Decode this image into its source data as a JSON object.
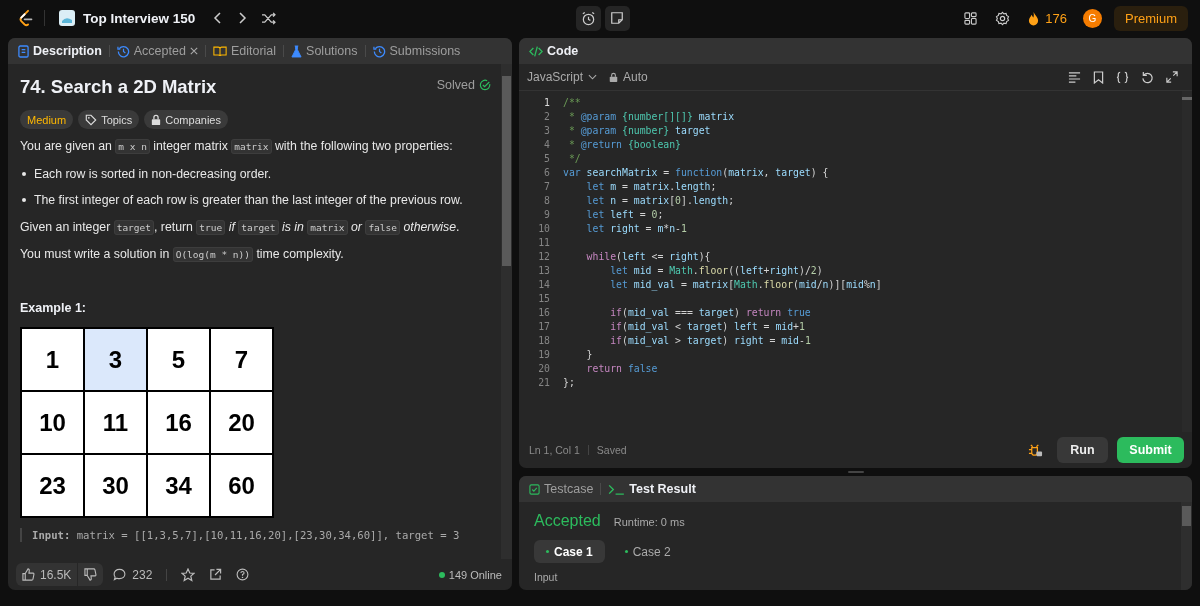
{
  "topbar": {
    "list_title": "Top Interview 150",
    "streak": "176",
    "avatar": "G",
    "premium": "Premium"
  },
  "left_tabs": [
    {
      "label": "Description",
      "kind": "doc",
      "selected": true,
      "closable": false
    },
    {
      "label": "Accepted",
      "kind": "history",
      "selected": false,
      "closable": true
    },
    {
      "label": "Editorial",
      "kind": "book",
      "selected": false,
      "closable": false
    },
    {
      "label": "Solutions",
      "kind": "flask",
      "selected": false,
      "closable": false
    },
    {
      "label": "Submissions",
      "kind": "history",
      "selected": false,
      "closable": false
    }
  ],
  "problem": {
    "title": "74. Search a 2D Matrix",
    "status": "Solved",
    "difficulty": "Medium",
    "tags": [
      {
        "label": "Topics",
        "kind": "tag"
      },
      {
        "label": "Companies",
        "kind": "lock"
      }
    ],
    "paragraphs": [
      {
        "kind": "para",
        "parts": [
          {
            "kind": "text",
            "text": "You are given an "
          },
          {
            "kind": "code",
            "text": "m x n"
          },
          {
            "kind": "text",
            "text": " integer matrix "
          },
          {
            "kind": "code",
            "text": "matrix"
          },
          {
            "kind": "text",
            "text": " with the following two properties:"
          }
        ]
      },
      {
        "kind": "bullet",
        "parts": [
          {
            "kind": "text",
            "text": "Each row is sorted in non-decreasing order."
          }
        ]
      },
      {
        "kind": "bullet",
        "parts": [
          {
            "kind": "text",
            "text": "The first integer of each row is greater than the last integer of the previous row."
          }
        ]
      },
      {
        "kind": "para",
        "parts": [
          {
            "kind": "text",
            "text": "Given an integer "
          },
          {
            "kind": "code",
            "text": "target"
          },
          {
            "kind": "text",
            "text": ", return "
          },
          {
            "kind": "code",
            "text": "true"
          },
          {
            "kind": "italic",
            "text": " if "
          },
          {
            "kind": "code",
            "text": "target"
          },
          {
            "kind": "italic",
            "text": " is in "
          },
          {
            "kind": "code",
            "text": "matrix"
          },
          {
            "kind": "italic",
            "text": " or "
          },
          {
            "kind": "code",
            "text": "false"
          },
          {
            "kind": "italic",
            "text": " otherwise"
          },
          {
            "kind": "text",
            "text": "."
          }
        ]
      },
      {
        "kind": "para",
        "parts": [
          {
            "kind": "text",
            "text": "You must write a solution in "
          },
          {
            "kind": "code",
            "text": "O(log(m * n))"
          },
          {
            "kind": "text",
            "text": " time complexity."
          }
        ]
      }
    ],
    "example_title": "Example 1:",
    "matrix": [
      [
        {
          "value": "1",
          "selected": false
        },
        {
          "value": "3",
          "selected": true
        },
        {
          "value": "5",
          "selected": false
        },
        {
          "value": "7",
          "selected": false
        }
      ],
      [
        {
          "value": "10",
          "selected": false
        },
        {
          "value": "11",
          "selected": false
        },
        {
          "value": "16",
          "selected": false
        },
        {
          "value": "20",
          "selected": false
        }
      ],
      [
        {
          "value": "23",
          "selected": false
        },
        {
          "value": "30",
          "selected": false
        },
        {
          "value": "34",
          "selected": false
        },
        {
          "value": "60",
          "selected": false
        }
      ]
    ],
    "example_input": "**Input:** matrix = [[1,3,5,7],[10,11,16,20],[23,30,34,60]], target = 3"
  },
  "bottom_bar": {
    "likes": "16.5K",
    "comments": "232",
    "online": "149 Online"
  },
  "code_panel": {
    "title": "Code",
    "language": "JavaScript",
    "mode": "Auto",
    "cursor": "Ln 1, Col 1",
    "save_state": "Saved",
    "run": "Run",
    "submit": "Submit",
    "lines": [
      {
        "number": "1",
        "tokens": [
          {
            "kind": "comment",
            "text": "/**"
          }
        ]
      },
      {
        "number": "2",
        "tokens": [
          {
            "kind": "comment",
            "text": " * "
          },
          {
            "kind": "doctag",
            "text": "@param "
          },
          {
            "kind": "type",
            "text": "{number[][]}"
          },
          {
            "kind": "var",
            "text": " matrix"
          }
        ]
      },
      {
        "number": "3",
        "tokens": [
          {
            "kind": "comment",
            "text": " * "
          },
          {
            "kind": "doctag",
            "text": "@param "
          },
          {
            "kind": "type",
            "text": "{number}"
          },
          {
            "kind": "var",
            "text": " target"
          }
        ]
      },
      {
        "number": "4",
        "tokens": [
          {
            "kind": "comment",
            "text": " * "
          },
          {
            "kind": "doctag",
            "text": "@return "
          },
          {
            "kind": "type",
            "text": "{boolean}"
          }
        ]
      },
      {
        "number": "5",
        "tokens": [
          {
            "kind": "comment",
            "text": " */"
          }
        ]
      },
      {
        "number": "6",
        "tokens": [
          {
            "kind": "keyword",
            "text": "var"
          },
          {
            "kind": "var",
            "text": " searchMatrix "
          },
          {
            "kind": "plain",
            "text": "= "
          },
          {
            "kind": "keyword",
            "text": "function"
          },
          {
            "kind": "plain",
            "text": "("
          },
          {
            "kind": "var",
            "text": "matrix"
          },
          {
            "kind": "plain",
            "text": ", "
          },
          {
            "kind": "var",
            "text": "target"
          },
          {
            "kind": "plain",
            "text": ") {"
          }
        ]
      },
      {
        "number": "7",
        "tokens": [
          {
            "kind": "keyword",
            "text": "    let"
          },
          {
            "kind": "var",
            "text": " m "
          },
          {
            "kind": "plain",
            "text": "= "
          },
          {
            "kind": "var",
            "text": "matrix"
          },
          {
            "kind": "plain",
            "text": "."
          },
          {
            "kind": "var",
            "text": "length"
          },
          {
            "kind": "plain",
            "text": ";"
          }
        ]
      },
      {
        "number": "8",
        "tokens": [
          {
            "kind": "keyword",
            "text": "    let"
          },
          {
            "kind": "var",
            "text": " n "
          },
          {
            "kind": "plain",
            "text": "= "
          },
          {
            "kind": "var",
            "text": "matrix"
          },
          {
            "kind": "plain",
            "text": "["
          },
          {
            "kind": "number",
            "text": "0"
          },
          {
            "kind": "plain",
            "text": "]."
          },
          {
            "kind": "var",
            "text": "length"
          },
          {
            "kind": "plain",
            "text": ";"
          }
        ]
      },
      {
        "number": "9",
        "tokens": [
          {
            "kind": "keyword",
            "text": "    let"
          },
          {
            "kind": "var",
            "text": " left "
          },
          {
            "kind": "plain",
            "text": "= "
          },
          {
            "kind": "number",
            "text": "0"
          },
          {
            "kind": "plain",
            "text": ";"
          }
        ]
      },
      {
        "number": "10",
        "tokens": [
          {
            "kind": "keyword",
            "text": "    let"
          },
          {
            "kind": "var",
            "text": " right "
          },
          {
            "kind": "plain",
            "text": "= "
          },
          {
            "kind": "var",
            "text": "m"
          },
          {
            "kind": "plain",
            "text": "*"
          },
          {
            "kind": "var",
            "text": "n"
          },
          {
            "kind": "plain",
            "text": "-"
          },
          {
            "kind": "number",
            "text": "1"
          }
        ]
      },
      {
        "number": "11"
      },
      {
        "number": "12",
        "tokens": [
          {
            "kind": "control",
            "text": "    while"
          },
          {
            "kind": "plain",
            "text": "("
          },
          {
            "kind": "var",
            "text": "left"
          },
          {
            "kind": "plain",
            "text": " <= "
          },
          {
            "kind": "var",
            "text": "right"
          },
          {
            "kind": "plain",
            "text": "){"
          }
        ]
      },
      {
        "number": "13",
        "tokens": [
          {
            "kind": "keyword",
            "text": "        let"
          },
          {
            "kind": "var",
            "text": " mid "
          },
          {
            "kind": "plain",
            "text": "= "
          },
          {
            "kind": "class",
            "text": "Math"
          },
          {
            "kind": "plain",
            "text": "."
          },
          {
            "kind": "func",
            "text": "floor"
          },
          {
            "kind": "plain",
            "text": "(("
          },
          {
            "kind": "var",
            "text": "left"
          },
          {
            "kind": "plain",
            "text": "+"
          },
          {
            "kind": "var",
            "text": "right"
          },
          {
            "kind": "plain",
            "text": ")/"
          },
          {
            "kind": "number",
            "text": "2"
          },
          {
            "kind": "plain",
            "text": ")"
          }
        ]
      },
      {
        "number": "14",
        "tokens": [
          {
            "kind": "keyword",
            "text": "        let"
          },
          {
            "kind": "var",
            "text": " mid_val "
          },
          {
            "kind": "plain",
            "text": "= "
          },
          {
            "kind": "var",
            "text": "matrix"
          },
          {
            "kind": "plain",
            "text": "["
          },
          {
            "kind": "class",
            "text": "Math"
          },
          {
            "kind": "plain",
            "text": "."
          },
          {
            "kind": "func",
            "text": "floor"
          },
          {
            "kind": "plain",
            "text": "("
          },
          {
            "kind": "var",
            "text": "mid"
          },
          {
            "kind": "plain",
            "text": "/"
          },
          {
            "kind": "var",
            "text": "n"
          },
          {
            "kind": "plain",
            "text": ")]["
          },
          {
            "kind": "var",
            "text": "mid"
          },
          {
            "kind": "plain",
            "text": "%"
          },
          {
            "kind": "var",
            "text": "n"
          },
          {
            "kind": "plain",
            "text": "]"
          }
        ]
      },
      {
        "number": "15"
      },
      {
        "number": "16",
        "tokens": [
          {
            "kind": "control",
            "text": "        if"
          },
          {
            "kind": "plain",
            "text": "("
          },
          {
            "kind": "var",
            "text": "mid_val"
          },
          {
            "kind": "plain",
            "text": " === "
          },
          {
            "kind": "var",
            "text": "target"
          },
          {
            "kind": "plain",
            "text": ") "
          },
          {
            "kind": "control",
            "text": "return "
          },
          {
            "kind": "keyword",
            "text": "true"
          }
        ]
      },
      {
        "number": "17",
        "tokens": [
          {
            "kind": "control",
            "text": "        if"
          },
          {
            "kind": "plain",
            "text": "("
          },
          {
            "kind": "var",
            "text": "mid_val"
          },
          {
            "kind": "plain",
            "text": " < "
          },
          {
            "kind": "var",
            "text": "target"
          },
          {
            "kind": "plain",
            "text": ") "
          },
          {
            "kind": "var",
            "text": "left"
          },
          {
            "kind": "plain",
            "text": " = "
          },
          {
            "kind": "var",
            "text": "mid"
          },
          {
            "kind": "plain",
            "text": "+"
          },
          {
            "kind": "number",
            "text": "1"
          }
        ]
      },
      {
        "number": "18",
        "tokens": [
          {
            "kind": "control",
            "text": "        if"
          },
          {
            "kind": "plain",
            "text": "("
          },
          {
            "kind": "var",
            "text": "mid_val"
          },
          {
            "kind": "plain",
            "text": " > "
          },
          {
            "kind": "var",
            "text": "target"
          },
          {
            "kind": "plain",
            "text": ") "
          },
          {
            "kind": "var",
            "text": "right"
          },
          {
            "kind": "plain",
            "text": " = "
          },
          {
            "kind": "var",
            "text": "mid"
          },
          {
            "kind": "plain",
            "text": "-"
          },
          {
            "kind": "number",
            "text": "1"
          }
        ]
      },
      {
        "number": "19",
        "tokens": [
          {
            "kind": "plain",
            "text": "    }"
          }
        ]
      },
      {
        "number": "20",
        "tokens": [
          {
            "kind": "control",
            "text": "    return "
          },
          {
            "kind": "keyword",
            "text": "false"
          }
        ]
      },
      {
        "number": "21",
        "tokens": [
          {
            "kind": "plain",
            "text": "};"
          }
        ]
      }
    ]
  },
  "result_panel": {
    "tabs": [
      {
        "label": "Testcase",
        "kind": "check",
        "selected": false
      },
      {
        "label": "Test Result",
        "kind": "terminal",
        "selected": true
      }
    ],
    "verdict": "Accepted",
    "runtime": "Runtime: 0 ms",
    "cases": [
      {
        "label": "Case 1",
        "selected": true
      },
      {
        "label": "Case 2",
        "selected": false
      }
    ],
    "input_label": "Input"
  }
}
